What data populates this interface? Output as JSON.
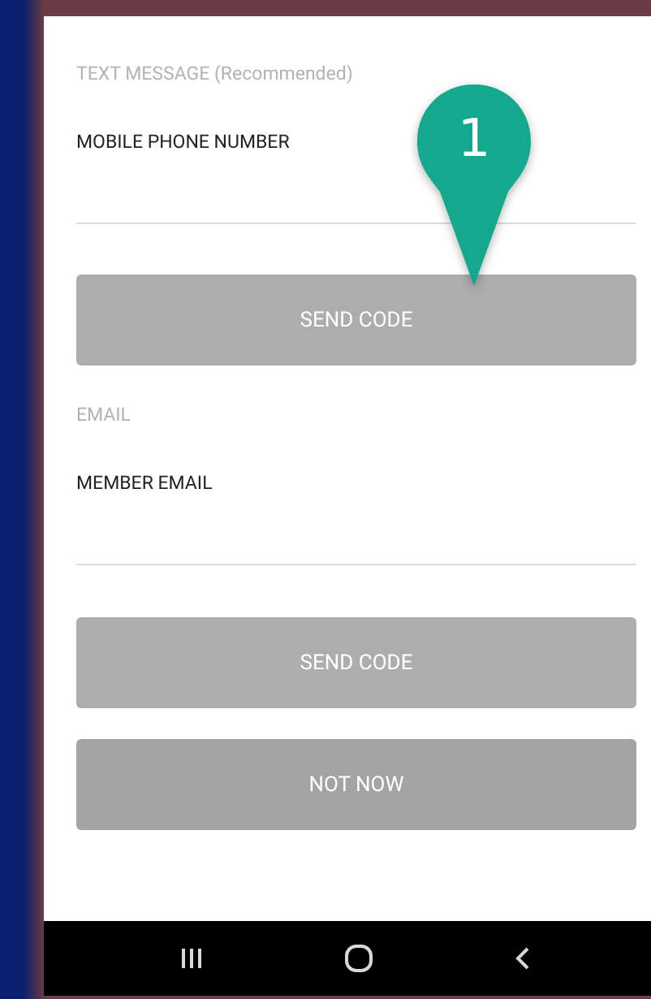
{
  "sections": [
    {
      "title": "TEXT MESSAGE (Recommended)",
      "field": {
        "label": "MOBILE PHONE NUMBER"
      },
      "button": "SEND CODE"
    },
    {
      "title": "EMAIL",
      "field": {
        "label": "MEMBER EMAIL"
      },
      "button": "SEND CODE"
    }
  ],
  "secondary_button": "NOT NOW",
  "callout": {
    "number": "1"
  }
}
